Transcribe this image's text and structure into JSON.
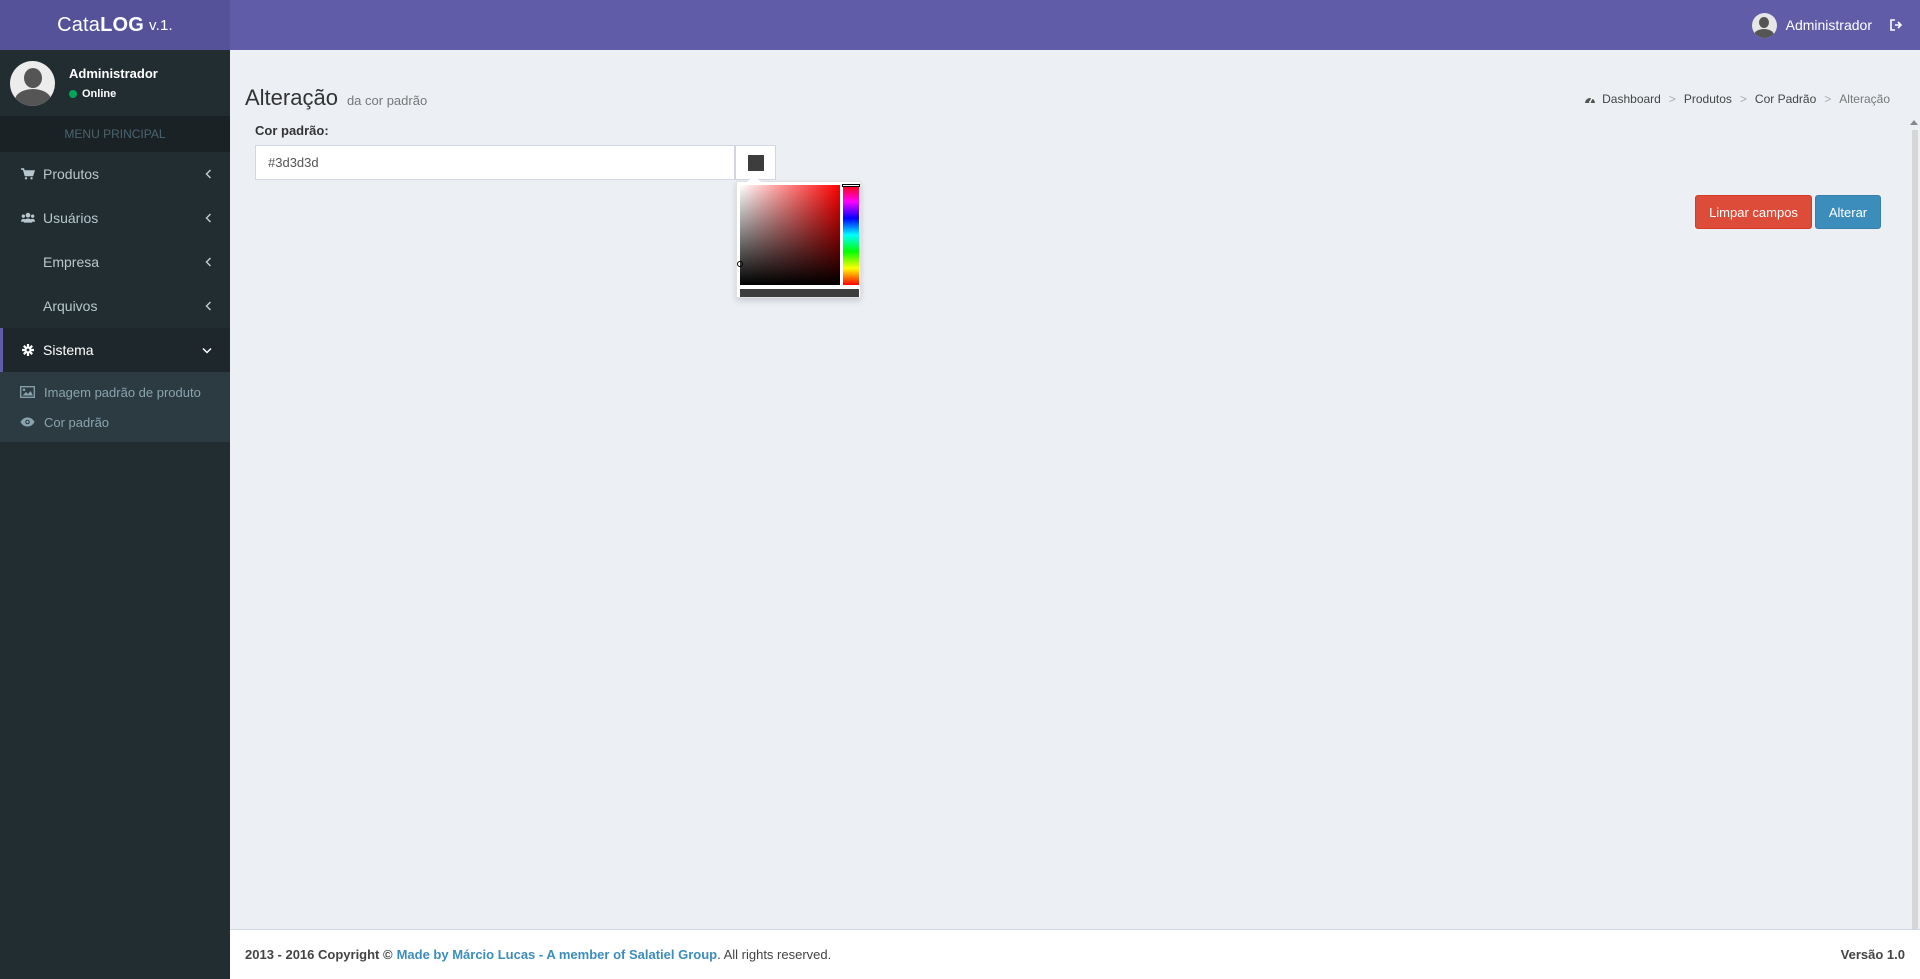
{
  "brand": {
    "prefix": "Cata",
    "bold": "LOG",
    "version": "v.1."
  },
  "topbar": {
    "user_name": "Administrador"
  },
  "sidebar": {
    "user": {
      "name": "Administrador",
      "status": "Online"
    },
    "menu_header": "MENU PRINCIPAL",
    "items": [
      {
        "label": "Produtos",
        "icon": "shopping-cart-icon"
      },
      {
        "label": "Usuários",
        "icon": "users-icon"
      },
      {
        "label": "Empresa",
        "icon": ""
      },
      {
        "label": "Arquivos",
        "icon": ""
      },
      {
        "label": "Sistema",
        "icon": "gear-icon",
        "active": true
      }
    ],
    "subitems": [
      {
        "label": "Imagem padrão de produto",
        "icon": "image-icon"
      },
      {
        "label": "Cor padrão",
        "icon": "eye-icon"
      }
    ]
  },
  "page": {
    "title": "Alteração",
    "subtitle": "da cor padrão",
    "breadcrumb": [
      "Dashboard",
      "Produtos",
      "Cor Padrão",
      "Alteração"
    ]
  },
  "form": {
    "label": "Cor padrão:",
    "value": "#3d3d3d",
    "swatch_color": "#3d3d3d"
  },
  "buttons": {
    "clear": "Limpar campos",
    "submit": "Alterar"
  },
  "footer": {
    "years": "2013 - 2016 Copyright ©",
    "link": "Made by Márcio Lucas - A member of Salatiel Group",
    "rights": ". All rights reserved.",
    "version": "Versão 1.0"
  },
  "colors": {
    "brand": "#605ca8",
    "sidebar": "#222d32",
    "danger": "#dd4b39",
    "primary": "#3c8dbc"
  }
}
